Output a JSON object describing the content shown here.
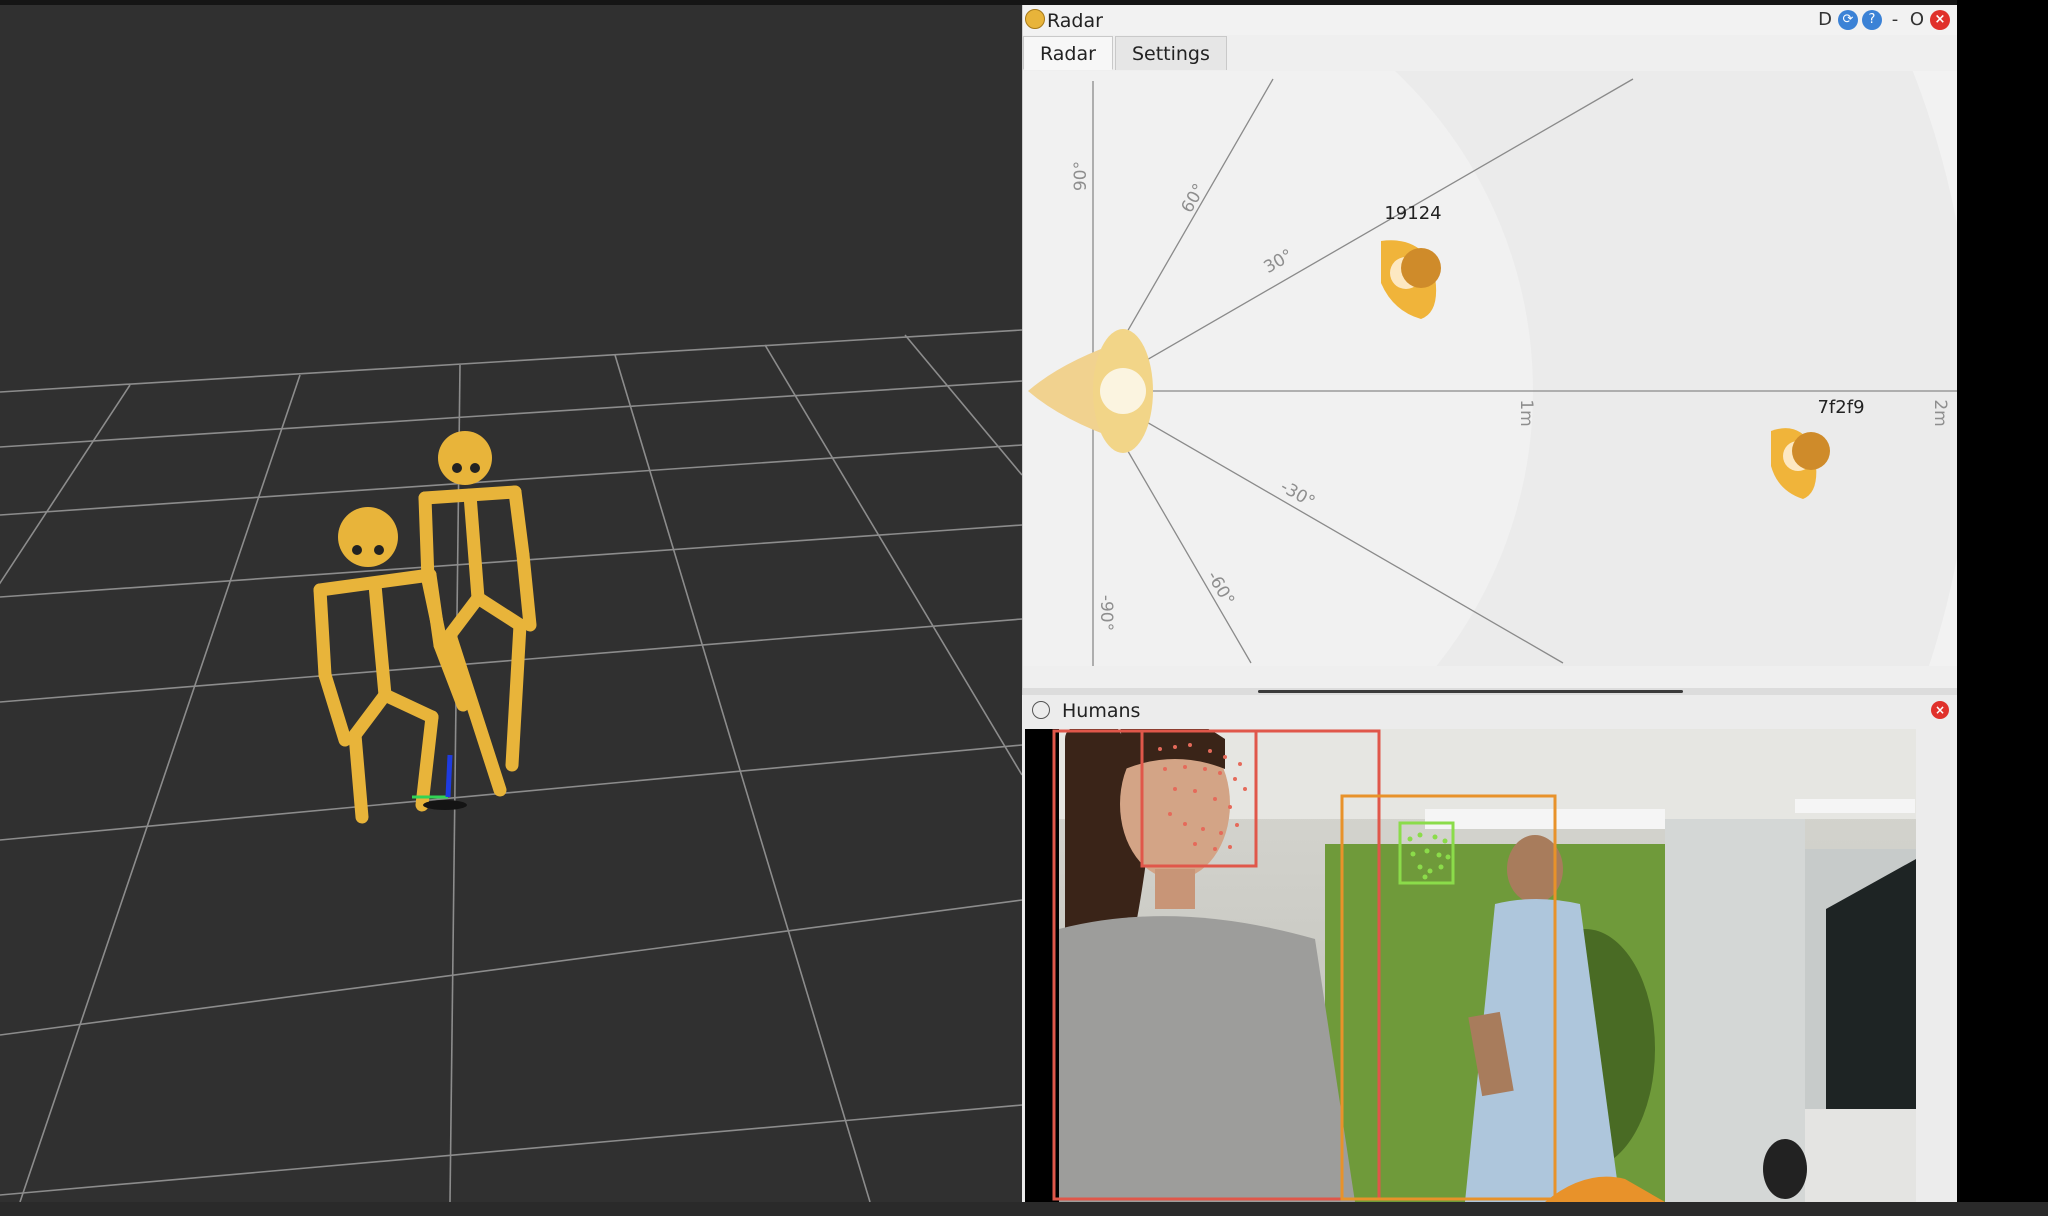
{
  "radar_window": {
    "title": "Radar",
    "controls": {
      "d": "D",
      "min": "-",
      "restore": "O",
      "close": "×"
    },
    "tabs": [
      {
        "label": "Radar",
        "active": true
      },
      {
        "label": "Settings",
        "active": false
      }
    ],
    "angle_labels": [
      "90°",
      "60°",
      "30°",
      "-30°",
      "-60°",
      "-90°"
    ],
    "distance_labels": [
      "1m",
      "2m"
    ],
    "persons": [
      {
        "id": "19124"
      },
      {
        "id": "7f2f9"
      }
    ]
  },
  "humans_window": {
    "title": "Humans",
    "close": "×"
  },
  "colors": {
    "viewport_bg": "#303030",
    "skeleton": "#e8b43a",
    "radar_marker": "#e0a23a",
    "face_box_1": "#e0574a",
    "face_box_2": "#8bdc4a",
    "body_box_1": "#e0574a",
    "body_box_2": "#e8922a"
  },
  "icons": [
    "radar-app-icon",
    "help-icon",
    "refresh-icon",
    "close-icon",
    "humans-app-icon"
  ]
}
